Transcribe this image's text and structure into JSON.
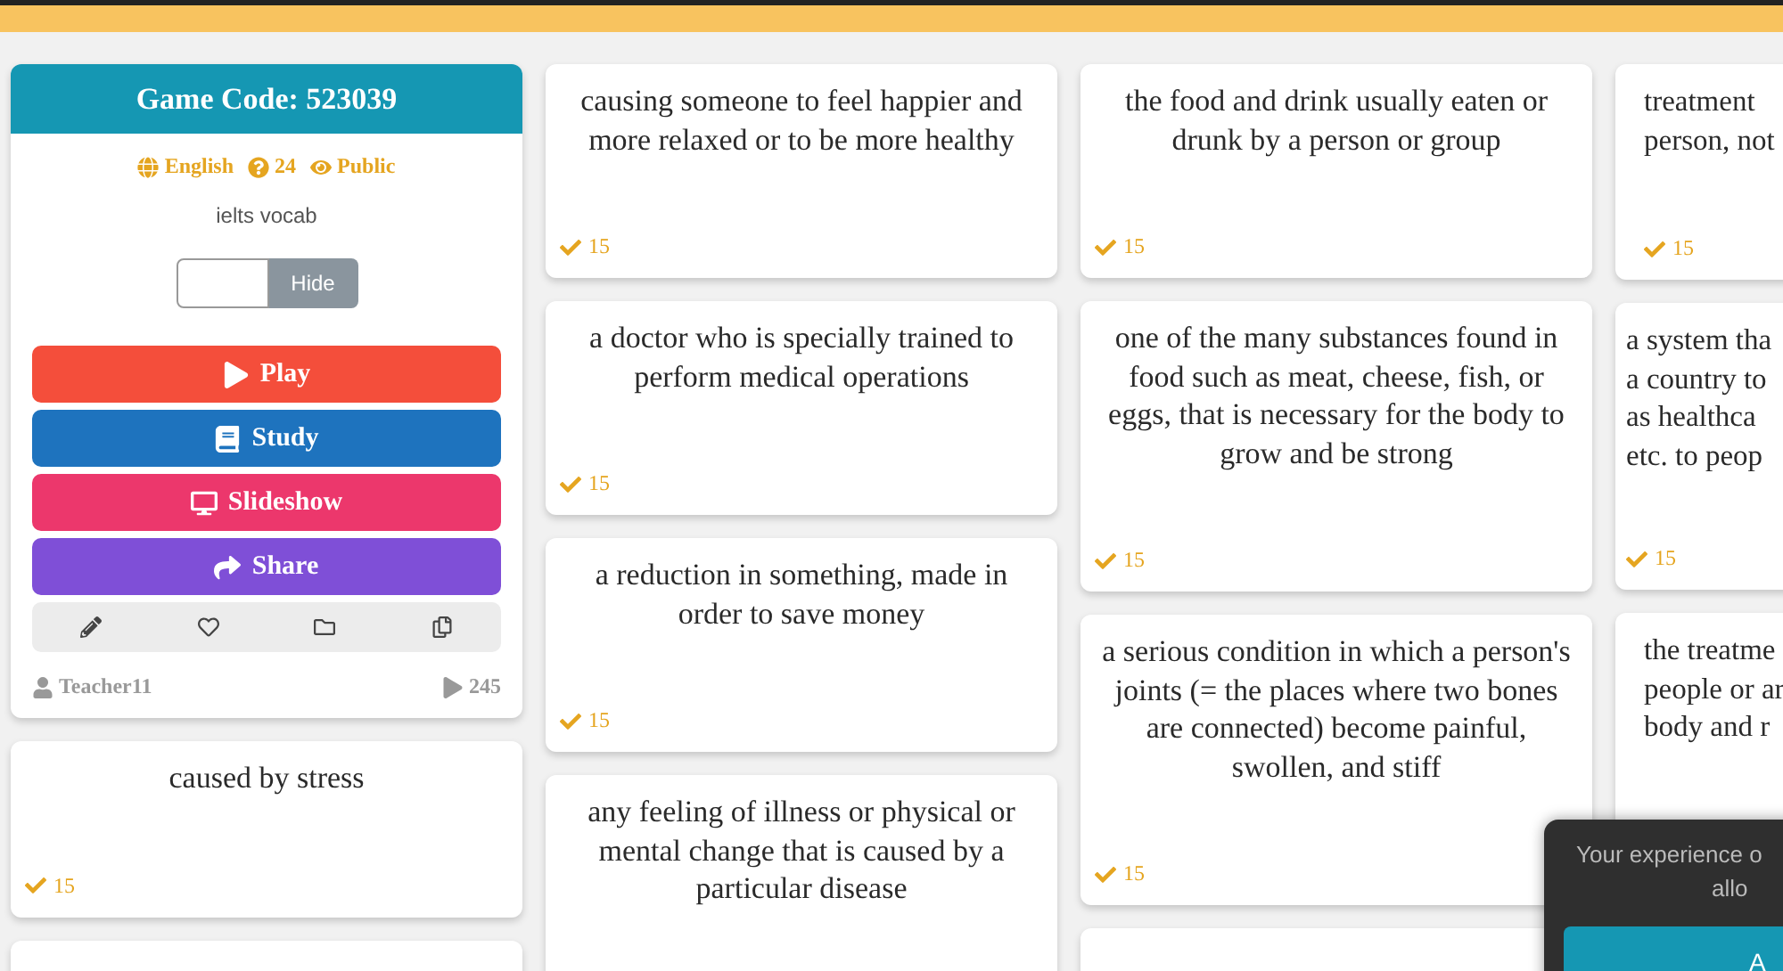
{
  "game_panel": {
    "title": "Game Code: 523039",
    "language": "English",
    "questions": "24",
    "visibility": "Public",
    "description": "ielts vocab",
    "toggle_button": "Hide",
    "buttons": [
      {
        "label": "Play",
        "kind": "play"
      },
      {
        "label": "Study",
        "kind": "study"
      },
      {
        "label": "Slideshow",
        "kind": "slideshow"
      },
      {
        "label": "Share",
        "kind": "share"
      }
    ],
    "tools": [
      {
        "kind": "edit"
      },
      {
        "kind": "favorite"
      },
      {
        "kind": "folder"
      },
      {
        "kind": "copy"
      }
    ],
    "author": "Teacher11",
    "plays": "245"
  },
  "columns": [
    [
      {
        "kind": "full",
        "text": "caused by stress",
        "count": "15"
      },
      {
        "kind": "stub"
      }
    ],
    [
      {
        "kind": "full",
        "text": "causing someone to feel happier and more relaxed or to be more healthy",
        "count": "15"
      },
      {
        "kind": "full",
        "text": "a doctor who is specially trained to perform medical operations",
        "count": "15"
      },
      {
        "kind": "full",
        "text": "a reduction in something, made in order to save money",
        "count": "15"
      },
      {
        "kind": "open",
        "text": "any feeling of illness or physical or mental change that is caused by a particular disease"
      }
    ],
    [
      {
        "kind": "full",
        "text": "the food and drink usually eaten or drunk by a person or group",
        "count": "15"
      },
      {
        "kind": "full",
        "text": "one of the many substances found in food such as meat, cheese, fish, or eggs, that is necessary for the body to grow and be strong",
        "count": "15"
      },
      {
        "kind": "full",
        "text": "a serious condition in which a person's joints (= the places where two bones are connected) become painful, swollen, and stiff",
        "count": "15"
      },
      {
        "kind": "stub"
      }
    ],
    [
      {
        "kind": "partial",
        "lines": [
          "treatment",
          "person, not"
        ],
        "count": "15"
      },
      {
        "kind": "partial",
        "lines": [
          "a system tha",
          "a country to",
          "as healthca",
          "etc. to peop"
        ],
        "count": "15"
      },
      {
        "kind": "partial",
        "lines": [
          "the treatme",
          "people or ar",
          "body and r"
        ]
      }
    ]
  ],
  "cookie_notice": {
    "lines": [
      "Your experience o",
      "allo"
    ],
    "button": "A"
  }
}
